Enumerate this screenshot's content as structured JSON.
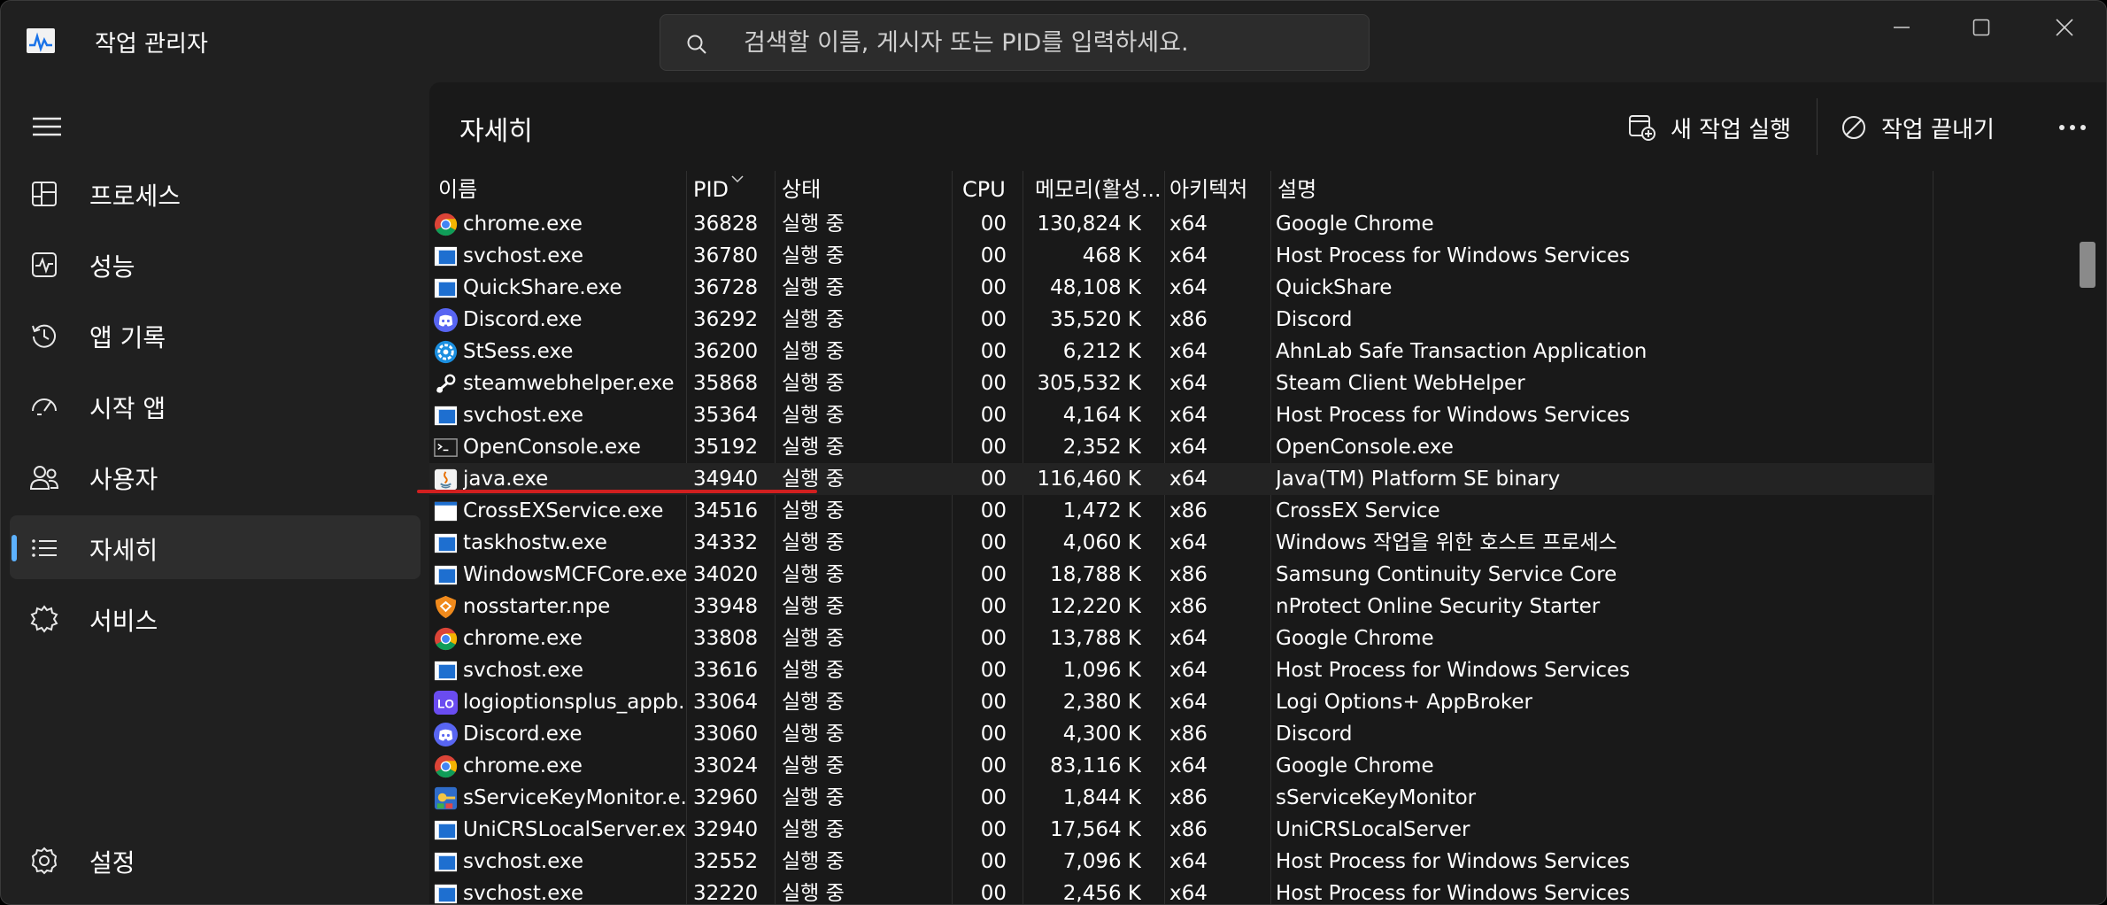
{
  "app": {
    "title": "작업 관리자"
  },
  "search": {
    "placeholder": "검색할 이름, 게시자 또는 PID를 입력하세요."
  },
  "sidebar": {
    "items": [
      {
        "label": "프로세스",
        "icon": "processes-icon"
      },
      {
        "label": "성능",
        "icon": "performance-icon"
      },
      {
        "label": "앱 기록",
        "icon": "app-history-icon"
      },
      {
        "label": "시작 앱",
        "icon": "startup-apps-icon"
      },
      {
        "label": "사용자",
        "icon": "users-icon"
      },
      {
        "label": "자세히",
        "icon": "details-icon",
        "active": true
      },
      {
        "label": "서비스",
        "icon": "services-icon"
      }
    ],
    "settings_label": "설정"
  },
  "main": {
    "title": "자세히",
    "run_new_task": "새 작업 실행",
    "end_task": "작업 끝내기"
  },
  "table": {
    "headers": {
      "name": "이름",
      "pid": "PID",
      "status": "상태",
      "cpu": "CPU",
      "memory": "메모리(활성...",
      "arch": "아키텍처",
      "desc": "설명"
    },
    "sorted_column": "PID",
    "rows": [
      {
        "name": "chrome.exe",
        "pid": "36828",
        "status": "실행 중",
        "cpu": "00",
        "mem": "130,824 K",
        "arch": "x64",
        "desc": "Google Chrome",
        "icon": "chrome"
      },
      {
        "name": "svchost.exe",
        "pid": "36780",
        "status": "실행 중",
        "cpu": "00",
        "mem": "468 K",
        "arch": "x64",
        "desc": "Host Process for Windows Services",
        "icon": "generic"
      },
      {
        "name": "QuickShare.exe",
        "pid": "36728",
        "status": "실행 중",
        "cpu": "00",
        "mem": "48,108 K",
        "arch": "x64",
        "desc": "QuickShare",
        "icon": "generic"
      },
      {
        "name": "Discord.exe",
        "pid": "36292",
        "status": "실행 중",
        "cpu": "00",
        "mem": "35,520 K",
        "arch": "x86",
        "desc": "Discord",
        "icon": "discord"
      },
      {
        "name": "StSess.exe",
        "pid": "36200",
        "status": "실행 중",
        "cpu": "00",
        "mem": "6,212 K",
        "arch": "x64",
        "desc": "AhnLab Safe Transaction Application",
        "icon": "ahnlab"
      },
      {
        "name": "steamwebhelper.exe",
        "pid": "35868",
        "status": "실행 중",
        "cpu": "00",
        "mem": "305,532 K",
        "arch": "x64",
        "desc": "Steam Client WebHelper",
        "icon": "steam"
      },
      {
        "name": "svchost.exe",
        "pid": "35364",
        "status": "실행 중",
        "cpu": "00",
        "mem": "4,164 K",
        "arch": "x64",
        "desc": "Host Process for Windows Services",
        "icon": "generic"
      },
      {
        "name": "OpenConsole.exe",
        "pid": "35192",
        "status": "실행 중",
        "cpu": "00",
        "mem": "2,352 K",
        "arch": "x64",
        "desc": "OpenConsole.exe",
        "icon": "console"
      },
      {
        "name": "java.exe",
        "pid": "34940",
        "status": "실행 중",
        "cpu": "00",
        "mem": "116,460 K",
        "arch": "x64",
        "desc": "Java(TM) Platform SE binary",
        "icon": "java",
        "selected": true
      },
      {
        "name": "CrossEXService.exe",
        "pid": "34516",
        "status": "실행 중",
        "cpu": "00",
        "mem": "1,472 K",
        "arch": "x86",
        "desc": "CrossEX Service",
        "icon": "blank"
      },
      {
        "name": "taskhostw.exe",
        "pid": "34332",
        "status": "실행 중",
        "cpu": "00",
        "mem": "4,060 K",
        "arch": "x64",
        "desc": "Windows 작업을 위한 호스트 프로세스",
        "icon": "generic"
      },
      {
        "name": "WindowsMCFCore.exe",
        "pid": "34020",
        "status": "실행 중",
        "cpu": "00",
        "mem": "18,788 K",
        "arch": "x86",
        "desc": "Samsung Continuity Service Core",
        "icon": "generic"
      },
      {
        "name": "nosstarter.npe",
        "pid": "33948",
        "status": "실행 중",
        "cpu": "00",
        "mem": "12,220 K",
        "arch": "x86",
        "desc": "nProtect Online Security Starter",
        "icon": "nprotect"
      },
      {
        "name": "chrome.exe",
        "pid": "33808",
        "status": "실행 중",
        "cpu": "00",
        "mem": "13,788 K",
        "arch": "x64",
        "desc": "Google Chrome",
        "icon": "chrome"
      },
      {
        "name": "svchost.exe",
        "pid": "33616",
        "status": "실행 중",
        "cpu": "00",
        "mem": "1,096 K",
        "arch": "x64",
        "desc": "Host Process for Windows Services",
        "icon": "generic"
      },
      {
        "name": "logioptionsplus_appb...",
        "pid": "33064",
        "status": "실행 중",
        "cpu": "00",
        "mem": "2,380 K",
        "arch": "x64",
        "desc": "Logi Options+ AppBroker",
        "icon": "logi"
      },
      {
        "name": "Discord.exe",
        "pid": "33060",
        "status": "실행 중",
        "cpu": "00",
        "mem": "4,300 K",
        "arch": "x86",
        "desc": "Discord",
        "icon": "discord"
      },
      {
        "name": "chrome.exe",
        "pid": "33024",
        "status": "실행 중",
        "cpu": "00",
        "mem": "83,116 K",
        "arch": "x64",
        "desc": "Google Chrome",
        "icon": "chrome"
      },
      {
        "name": "sServiceKeyMonitor.e...",
        "pid": "32960",
        "status": "실행 중",
        "cpu": "00",
        "mem": "1,844 K",
        "arch": "x86",
        "desc": "sServiceKeyMonitor",
        "icon": "keymon"
      },
      {
        "name": "UniCRSLocalServer.exe",
        "pid": "32940",
        "status": "실행 중",
        "cpu": "00",
        "mem": "17,564 K",
        "arch": "x86",
        "desc": "UniCRSLocalServer",
        "icon": "generic"
      },
      {
        "name": "svchost.exe",
        "pid": "32552",
        "status": "실행 중",
        "cpu": "00",
        "mem": "7,096 K",
        "arch": "x64",
        "desc": "Host Process for Windows Services",
        "icon": "generic"
      },
      {
        "name": "svchost.exe",
        "pid": "32220",
        "status": "실행 중",
        "cpu": "00",
        "mem": "2,456 K",
        "arch": "x64",
        "desc": "Host Process for Windows Services",
        "icon": "generic"
      }
    ]
  },
  "colors": {
    "accent": "#5db2ff",
    "annotation": "#d11f1f"
  }
}
